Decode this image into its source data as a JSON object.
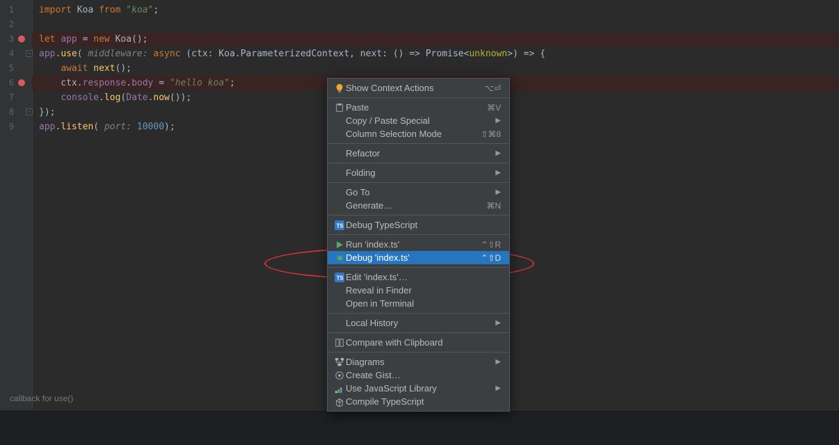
{
  "editor": {
    "lines": [
      {
        "n": "1",
        "bp": false,
        "tokens": [
          {
            "c": "kw",
            "t": "import "
          },
          {
            "c": "",
            "t": "Koa "
          },
          {
            "c": "kw",
            "t": "from "
          },
          {
            "c": "str",
            "t": "\"koa\""
          },
          {
            "c": "",
            "t": ";"
          }
        ]
      },
      {
        "n": "2",
        "bp": false,
        "tokens": []
      },
      {
        "n": "3",
        "bp": true,
        "hl": true,
        "tokens": [
          {
            "c": "kw",
            "t": "let "
          },
          {
            "c": "id",
            "t": "app"
          },
          {
            "c": "",
            "t": " = "
          },
          {
            "c": "kw",
            "t": "new "
          },
          {
            "c": "",
            "t": "Koa();"
          }
        ]
      },
      {
        "n": "4",
        "bp": false,
        "fold": true,
        "tokens": [
          {
            "c": "id",
            "t": "app"
          },
          {
            "c": "",
            "t": "."
          },
          {
            "c": "fn",
            "t": "use"
          },
          {
            "c": "",
            "t": "( "
          },
          {
            "c": "param",
            "t": "middleware:"
          },
          {
            "c": "",
            "t": " "
          },
          {
            "c": "kw",
            "t": "async"
          },
          {
            "c": "",
            "t": " (ctx: Koa.ParameterizedContext, next: () => Promise<"
          },
          {
            "c": "warn",
            "t": "unknown"
          },
          {
            "c": "",
            "t": ">) => {"
          }
        ]
      },
      {
        "n": "5",
        "bp": false,
        "tokens": [
          {
            "c": "",
            "t": "    "
          },
          {
            "c": "kw",
            "t": "await "
          },
          {
            "c": "fn",
            "t": "next"
          },
          {
            "c": "",
            "t": "();"
          }
        ]
      },
      {
        "n": "6",
        "bp": true,
        "hl": true,
        "tokens": [
          {
            "c": "",
            "t": "    ctx."
          },
          {
            "c": "id",
            "t": "response"
          },
          {
            "c": "",
            "t": "."
          },
          {
            "c": "id",
            "t": "body"
          },
          {
            "c": "",
            "t": " = "
          },
          {
            "c": "str",
            "t": "\"hello koa\""
          },
          {
            "c": "",
            "t": ";"
          }
        ]
      },
      {
        "n": "7",
        "bp": false,
        "tokens": [
          {
            "c": "",
            "t": "    "
          },
          {
            "c": "id",
            "t": "console"
          },
          {
            "c": "",
            "t": "."
          },
          {
            "c": "fn",
            "t": "log"
          },
          {
            "c": "",
            "t": "("
          },
          {
            "c": "id",
            "t": "Date"
          },
          {
            "c": "",
            "t": "."
          },
          {
            "c": "fn",
            "t": "now"
          },
          {
            "c": "",
            "t": "());"
          }
        ]
      },
      {
        "n": "8",
        "bp": false,
        "fold": true,
        "tokens": [
          {
            "c": "",
            "t": "});"
          }
        ]
      },
      {
        "n": "9",
        "bp": false,
        "tokens": [
          {
            "c": "id",
            "t": "app"
          },
          {
            "c": "",
            "t": "."
          },
          {
            "c": "fn",
            "t": "listen"
          },
          {
            "c": "",
            "t": "( "
          },
          {
            "c": "param",
            "t": "port:"
          },
          {
            "c": "",
            "t": " "
          },
          {
            "c": "num",
            "t": "10000"
          },
          {
            "c": "",
            "t": ");"
          }
        ]
      }
    ],
    "hint": "callback for use()"
  },
  "menu": {
    "groups": [
      [
        {
          "icon": "bulb",
          "label": "Show Context Actions",
          "shortcut": "⌥⏎"
        }
      ],
      [
        {
          "icon": "paste",
          "label": "Paste",
          "shortcut": "⌘V"
        },
        {
          "label": "Copy / Paste Special",
          "sub": true
        },
        {
          "label": "Column Selection Mode",
          "shortcut": "⇧⌘8"
        }
      ],
      [
        {
          "label": "Refactor",
          "sub": true
        }
      ],
      [
        {
          "label": "Folding",
          "sub": true
        }
      ],
      [
        {
          "label": "Go To",
          "sub": true
        },
        {
          "label": "Generate…",
          "shortcut": "⌘N"
        }
      ],
      [
        {
          "icon": "ts",
          "label": "Debug TypeScript"
        }
      ],
      [
        {
          "icon": "run",
          "label": "Run 'index.ts'",
          "shortcut": "⌃⇧R"
        },
        {
          "icon": "bug",
          "label": "Debug 'index.ts'",
          "shortcut": "⌃⇧D",
          "selected": true
        }
      ],
      [
        {
          "icon": "ts",
          "label": "Edit 'index.ts'…"
        },
        {
          "label": "Reveal in Finder"
        },
        {
          "label": "Open in Terminal"
        }
      ],
      [
        {
          "label": "Local History",
          "sub": true
        }
      ],
      [
        {
          "icon": "diff",
          "label": "Compare with Clipboard"
        }
      ],
      [
        {
          "icon": "diagram",
          "label": "Diagrams",
          "sub": true
        },
        {
          "icon": "gist",
          "label": "Create Gist…"
        },
        {
          "icon": "js",
          "label": "Use JavaScript Library",
          "sub": true
        },
        {
          "icon": "compile",
          "label": "Compile TypeScript"
        }
      ]
    ]
  }
}
